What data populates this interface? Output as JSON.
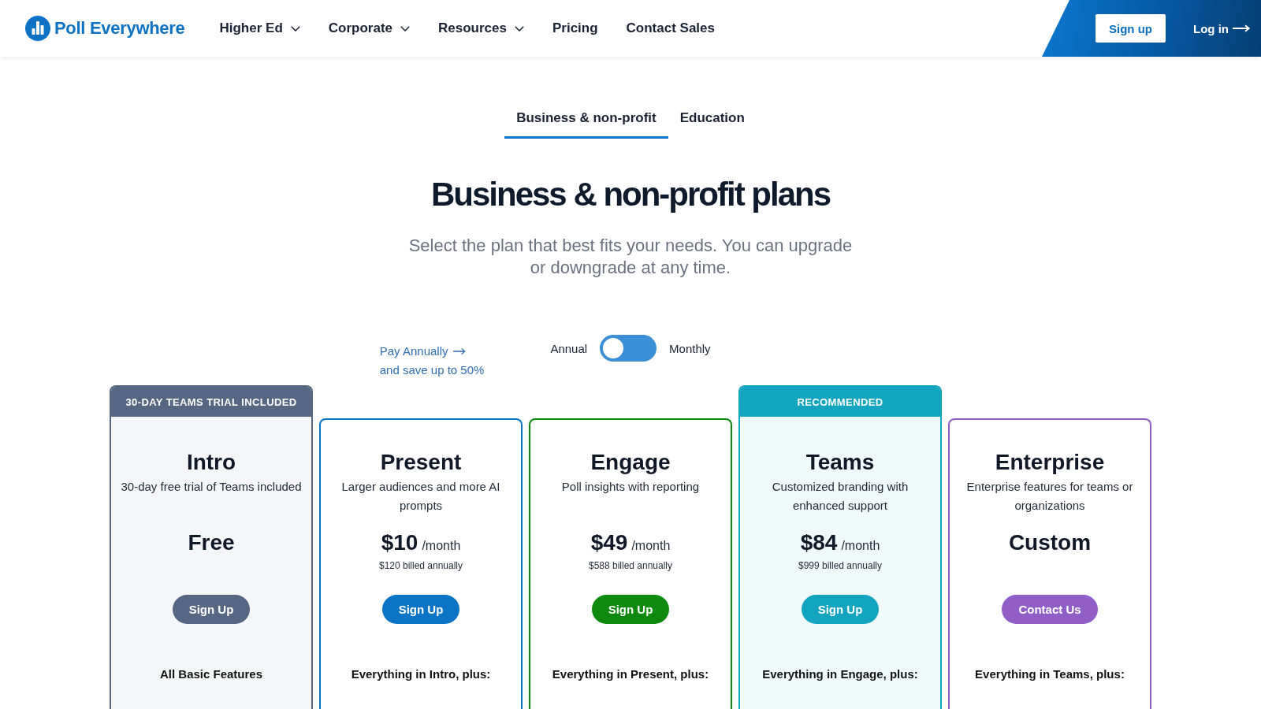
{
  "header": {
    "logo": "Poll Everywhere",
    "nav": [
      {
        "label": "Higher Ed",
        "has_menu": true
      },
      {
        "label": "Corporate",
        "has_menu": true
      },
      {
        "label": "Resources",
        "has_menu": true
      },
      {
        "label": "Pricing",
        "has_menu": false
      },
      {
        "label": "Contact Sales",
        "has_menu": false
      }
    ],
    "sign_up": "Sign up",
    "log_in": "Log in"
  },
  "tabs": [
    {
      "label": "Business & non-profit",
      "selected": true
    },
    {
      "label": "Education",
      "selected": false
    }
  ],
  "title": "Business & non-profit plans",
  "subtitle": "Select the plan that best fits your needs. You can upgrade or downgrade at any time.",
  "billing": {
    "promo_title": "Pay Annually",
    "promo_note": "and save up to 50%",
    "annual_label": "Annual",
    "monthly_label": "Monthly",
    "monthly": false
  },
  "plans": [
    {
      "badge": "30-DAY TEAMS TRIAL INCLUDED",
      "name": "Intro",
      "description": "30-day free trial of Teams included",
      "price": "Free",
      "button": "Sign Up",
      "features_heading": "All Basic Features",
      "color": "#566783"
    },
    {
      "name": "Present",
      "description": "Larger audiences and more AI prompts",
      "price": "$10",
      "period": "/month",
      "billed": "$120 billed annually",
      "button": "Sign Up",
      "features_heading": "Everything in Intro, plus:",
      "color": "#0b74c4"
    },
    {
      "name": "Engage",
      "description": "Poll insights with reporting",
      "price": "$49",
      "period": "/month",
      "billed": "$588 billed annually",
      "button": "Sign Up",
      "features_heading": "Everything in Present, plus:",
      "color": "#0d8a0d"
    },
    {
      "badge": "RECOMMENDED",
      "name": "Teams",
      "description": "Customized branding with enhanced support",
      "price": "$84",
      "period": "/month",
      "billed": "$999 billed annually",
      "button": "Sign Up",
      "features_heading": "Everything in Engage, plus:",
      "color": "#13a4bf"
    },
    {
      "name": "Enterprise",
      "description": "Enterprise features for teams or organizations",
      "price": "Custom",
      "button": "Contact Us",
      "features_heading": "Everything in Teams, plus:",
      "color": "#915ec8"
    }
  ]
}
